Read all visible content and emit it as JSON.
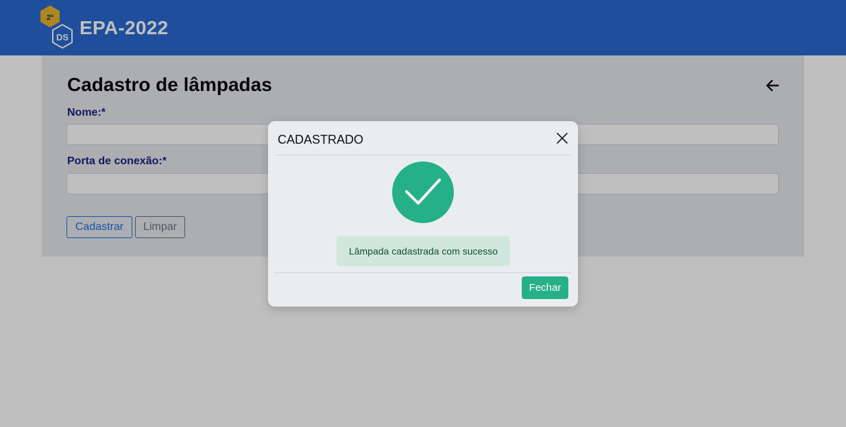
{
  "header": {
    "logo_badge": "2º",
    "logo_mark": "DS",
    "title": "EPA-2022"
  },
  "form": {
    "title": "Cadastro de lâmpadas",
    "fields": [
      {
        "label": "Nome:*",
        "value": ""
      },
      {
        "label": "Porta de conexão:*",
        "value": ""
      }
    ],
    "submit_label": "Cadastrar",
    "clear_label": "Limpar"
  },
  "modal": {
    "title": "CADASTRADO",
    "message": "Lâmpada cadastrada com sucesso",
    "close_label": "Fechar"
  },
  "icons": {
    "back": "arrow-left-icon",
    "close": "close-icon",
    "success": "checkmark-icon"
  },
  "colors": {
    "header_bg": "#2a6ad1",
    "primary": "#1f6fe5",
    "success": "#25b087",
    "badge": "#e9b62a",
    "alert_bg": "#d1e7dd",
    "alert_text": "#0f5132"
  }
}
